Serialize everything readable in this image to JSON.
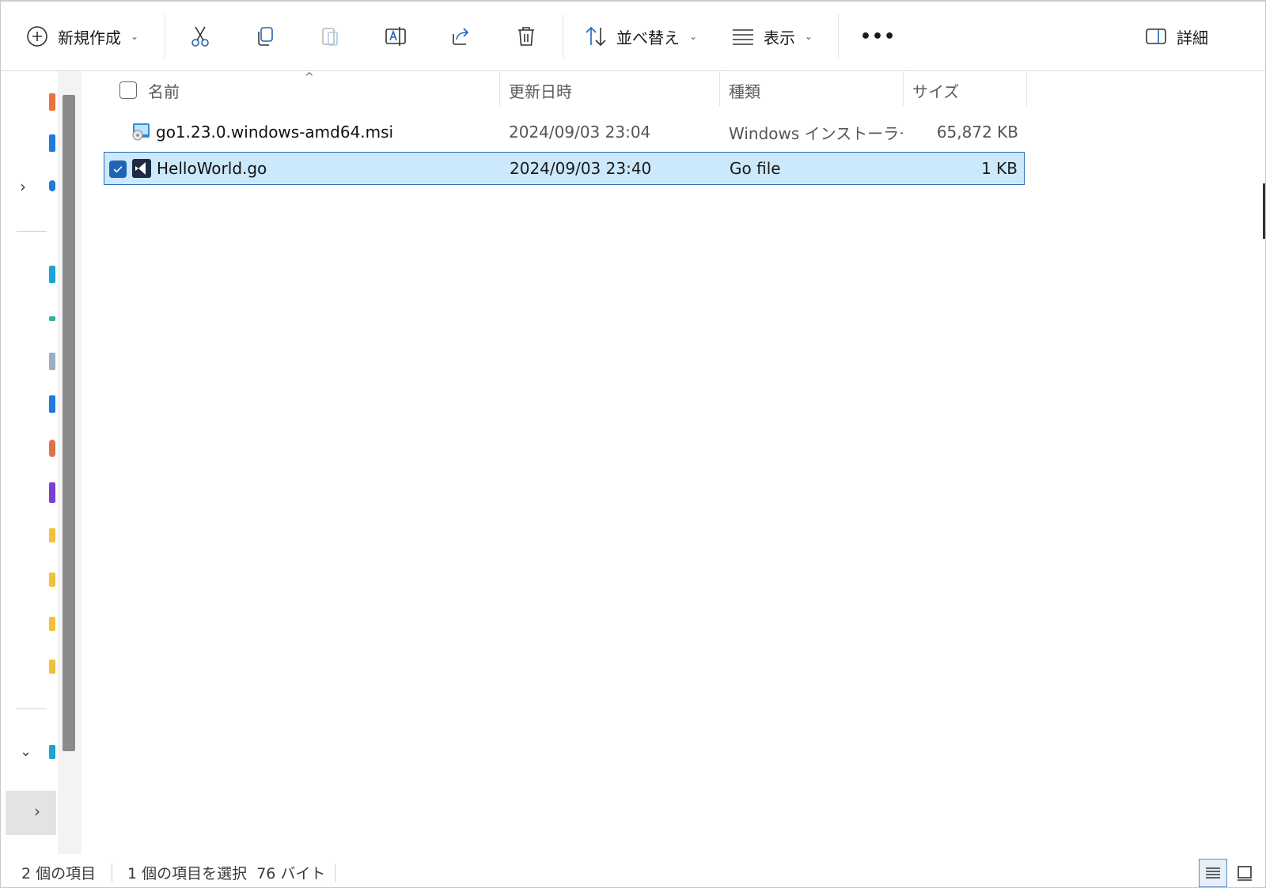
{
  "toolbar": {
    "new_label": "新規作成",
    "sort_label": "並べ替え",
    "view_label": "表示",
    "more_label": "•••",
    "details_label": "詳細"
  },
  "columns": {
    "name": "名前",
    "date": "更新日時",
    "type": "種類",
    "size": "サイズ"
  },
  "files": [
    {
      "name": "go1.23.0.windows-amd64.msi",
      "date": "2024/09/03 23:04",
      "type": "Windows インストーラー...",
      "size": "65,872 KB",
      "selected": false
    },
    {
      "name": "HelloWorld.go",
      "date": "2024/09/03 23:40",
      "type": "Go file",
      "size": "1 KB",
      "selected": true
    }
  ],
  "status": {
    "item_count": "2 個の項目",
    "selection": "1 個の項目を選択  76 バイト"
  },
  "colors": {
    "accent": "#1f65b6",
    "selection_bg": "#cce8fb",
    "icon_blue": "#1f65b6"
  }
}
